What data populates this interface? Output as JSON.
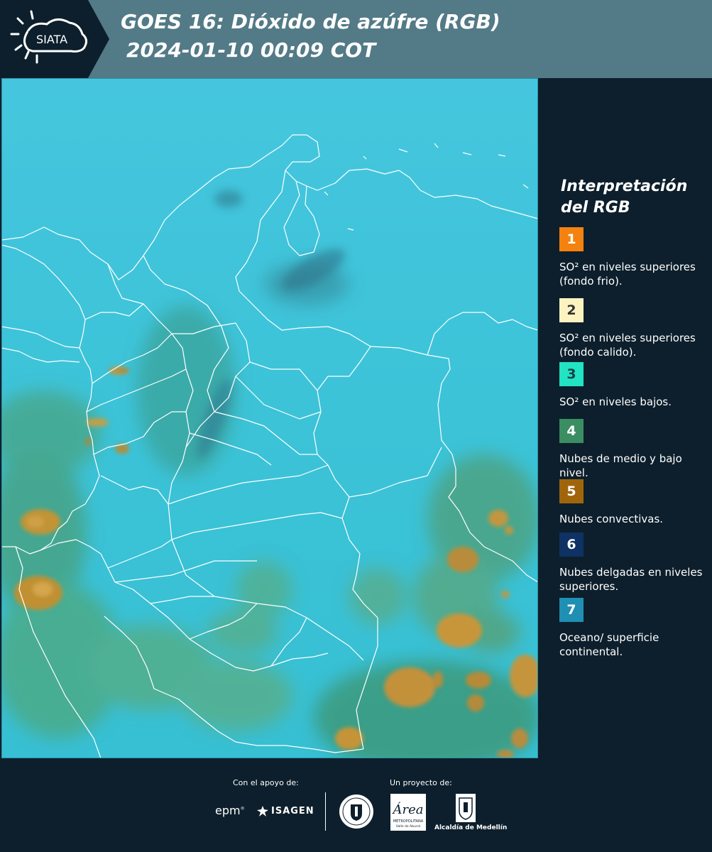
{
  "header": {
    "logo_text": "SIATA",
    "title_line1": "GOES 16: Dióxido de azúfre (RGB)",
    "title_line2": "2024-01-10 00:09 COT"
  },
  "colors": {
    "header_bg": "#537a87",
    "panel_bg": "#0d1f2c",
    "map_background": "#3fc4d9",
    "convective_clouds": "#b8892f",
    "mid_low_clouds": "#4a9a6a"
  },
  "legend": {
    "title_line1": "Interpretación",
    "title_line2": "del RGB",
    "items": [
      {
        "number": "1",
        "color": "#f5820f",
        "text_color": "#ffffff",
        "label": "SO² en niveles superiores (fondo frio)."
      },
      {
        "number": "2",
        "color": "#fdf3c0",
        "text_color": "#333333",
        "label": "SO² en niveles superiores (fondo calido)."
      },
      {
        "number": "3",
        "color": "#22e3c3",
        "text_color": "#14424a",
        "label": "SO² en niveles bajos."
      },
      {
        "number": "4",
        "color": "#3a8e62",
        "text_color": "#ffffff",
        "label": "Nubes de medio y bajo nivel."
      },
      {
        "number": "5",
        "color": "#a0650b",
        "text_color": "#ffffff",
        "label": "Nubes convectivas."
      },
      {
        "number": "6",
        "color": "#0d3263",
        "text_color": "#ffffff",
        "label": "Nubes delgadas en niveles superiores."
      },
      {
        "number": "7",
        "color": "#1f8fb3",
        "text_color": "#ffffff",
        "label": "Oceano/ superficie continental."
      }
    ]
  },
  "footer": {
    "support_label": "Con el apoyo de:",
    "project_label": "Un proyecto de:",
    "epm_text": "epm",
    "isagen_text": "ISAGEN",
    "area_text": "Área",
    "area_sub": "METROPOLITANA",
    "area_sub2": "Valle de Aburrá",
    "alcaldia_text": "Alcaldía de Medellín",
    "logos": [
      "epm-logo",
      "isagen-logo",
      "medellin-seal",
      "area-metropolitana-logo",
      "alcaldia-medellin-logo"
    ]
  }
}
